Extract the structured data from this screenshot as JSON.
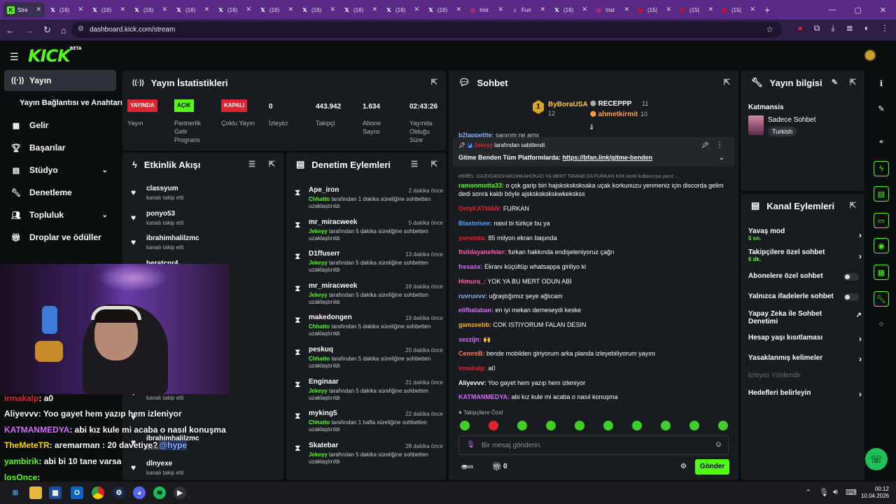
{
  "browser": {
    "tabs": [
      {
        "label": "Stre",
        "icon": "kick-icon",
        "color": "#53fc18"
      },
      {
        "label": "(16)",
        "icon": "x-icon",
        "color": "#ffffff"
      },
      {
        "label": "(16)",
        "icon": "x-icon",
        "color": "#ffffff"
      },
      {
        "label": "(16)",
        "icon": "x-icon",
        "color": "#ffffff"
      },
      {
        "label": "(16)",
        "icon": "x-icon",
        "color": "#ffffff"
      },
      {
        "label": "(16)",
        "icon": "x-icon",
        "color": "#ffffff"
      },
      {
        "label": "(16)",
        "icon": "x-icon",
        "color": "#ffffff"
      },
      {
        "label": "(16)",
        "icon": "x-icon",
        "color": "#ffffff"
      },
      {
        "label": "(16)",
        "icon": "x-icon",
        "color": "#ffffff"
      },
      {
        "label": "(16)",
        "icon": "x-icon",
        "color": "#ffffff"
      },
      {
        "label": "(16)",
        "icon": "x-icon",
        "color": "#ffffff"
      },
      {
        "label": "Inst",
        "icon": "instagram-icon",
        "color": "#e1306c"
      },
      {
        "label": "Furi",
        "icon": "tiktok-icon",
        "color": "#ffffff"
      },
      {
        "label": "(16)",
        "icon": "x-icon",
        "color": "#ffffff"
      },
      {
        "label": "Inst",
        "icon": "instagram-icon",
        "color": "#e1306c"
      },
      {
        "label": "(15(",
        "icon": "youtube-icon",
        "color": "#ff0000"
      },
      {
        "label": "(15(",
        "icon": "youtube-icon",
        "color": "#ff0000"
      },
      {
        "label": "(15(",
        "icon": "youtube-icon",
        "color": "#ff0000"
      }
    ],
    "new_tab": "+",
    "url": "dashboard.kick.com/stream"
  },
  "sidebar": {
    "items": [
      {
        "label": "Yayın",
        "icon": "broadcast-icon"
      },
      {
        "label": "Yayın Bağlantısı ve Anahtarı"
      },
      {
        "label": "Gelir",
        "icon": "money-icon"
      },
      {
        "label": "Başarılar",
        "icon": "trophy-icon"
      },
      {
        "label": "Stüdyo",
        "icon": "studio-icon"
      },
      {
        "label": "Denetleme",
        "icon": "wrench-icon"
      },
      {
        "label": "Topluluk",
        "icon": "community-icon"
      },
      {
        "label": "Droplar ve ödüller",
        "icon": "gift-icon"
      }
    ]
  },
  "stats": {
    "title": "Yayın İstatistikleri",
    "items": [
      {
        "badge": "YAYINDA",
        "badge_color": "#e0242f",
        "label": "Yayın"
      },
      {
        "badge": "AÇIK",
        "badge_color": "#53fc18",
        "label": "Partnerlik Gelir Programı"
      },
      {
        "badge": "KAPALI",
        "badge_color": "#e0242f",
        "label": "Çoklu Yayın"
      },
      {
        "value": "0",
        "label": "İzleyici"
      },
      {
        "value": "443.942",
        "label": "Takipçi"
      },
      {
        "value": "1.634",
        "label": "Abone Sayısı"
      },
      {
        "value": "02:43:26",
        "label": "Yayında Olduğu Süre"
      }
    ]
  },
  "activity": {
    "title": "Etkinlik Akışı",
    "rows": [
      {
        "name": "classyum",
        "sub": "kanalı takip etti",
        "time": "1 dakika önce"
      },
      {
        "name": "ponyo53",
        "sub": "kanalı takip etti",
        "time": "1 dakika önce"
      },
      {
        "name": "ibrahimhalilzmc",
        "sub": "kanalı takip etti",
        "time": "1 dakika önce"
      },
      {
        "name": "beratcnr4",
        "sub": "",
        "time": "2 dakika önce"
      },
      {
        "name": "",
        "sub": "",
        "time": "2 dakika önce"
      },
      {
        "name": "",
        "sub": "",
        "time": "3 dakika önce"
      },
      {
        "name": "",
        "sub": "",
        "time": "4 dakika önce"
      },
      {
        "name": "",
        "sub": "",
        "time": "4 dakika önce"
      },
      {
        "name": "",
        "sub": "kanalı takip etti",
        "time": "5 dakika önce"
      },
      {
        "name": "",
        "sub": "",
        "time": "5 dakika önce"
      },
      {
        "name": "ibrahimhalilzmc",
        "sub": "kanalı takip etti",
        "time": "6 dakika önce"
      },
      {
        "name": "dlnyexe",
        "sub": "kanalı takip etti",
        "time": "7 dakika önce"
      }
    ]
  },
  "moderation": {
    "title": "Denetim Eylemleri",
    "rows": [
      {
        "name": "Ape_iron",
        "time": "2 dakika önce",
        "mod": "Chhatto",
        "text": "tarafından 1 dakika süreliğine sohbetten uzaklaştırıldı"
      },
      {
        "name": "mr_miracweek",
        "time": "5 dakika önce",
        "mod": "Jekeyy",
        "text": "tarafından 5 dakika süreliğine sohbetten uzaklaştırıldı"
      },
      {
        "name": "D1ffuserr",
        "time": "13 dakika önce",
        "mod": "Jekeyy",
        "text": "tarafından 5 dakika süreliğine sohbetten uzaklaştırıldı"
      },
      {
        "name": "mr_miracweek",
        "time": "18 dakika önce",
        "mod": "Jekeyy",
        "text": "tarafından 5 dakika süreliğine sohbetten uzaklaştırıldı"
      },
      {
        "name": "makedongen",
        "time": "19 dakika önce",
        "mod": "Chhatto",
        "text": "tarafından 5 dakika süreliğine sohbetten uzaklaştırıldı"
      },
      {
        "name": "peskuq",
        "time": "20 dakika önce",
        "mod": "Chhatto",
        "text": "tarafından 5 dakika süreliğine sohbetten uzaklaştırıldı"
      },
      {
        "name": "Enginaar",
        "time": "21 dakika önce",
        "mod": "Jekeyy",
        "text": "tarafından 5 dakika süreliğine sohbetten uzaklaştırıldı"
      },
      {
        "name": "myking5",
        "time": "22 dakika önce",
        "mod": "Chhatto",
        "text": "tarafından 1 hafta süreliğine sohbetten uzaklaştırıldı"
      },
      {
        "name": "Skatebar",
        "time": "28 dakika önce",
        "mod": "Jekeyy",
        "text": "tarafından 5 dakika süreliğine sohbetten uzaklaştırıldı"
      }
    ]
  },
  "chat": {
    "title": "Sohbet",
    "top_gifter": {
      "rank": "1",
      "name": "ByBoraUSA",
      "count": "12"
    },
    "gifters": [
      {
        "name": "RECEPPP",
        "count": "11"
      },
      {
        "name": "ahmetkirmit",
        "count": "10"
      }
    ],
    "partial_line": {
      "name": "b2lappetite:",
      "text": "sanırım ne amx"
    },
    "pinned": {
      "by": "Jekeyy",
      "by_suffix": "tarafından sabitlendi",
      "text": "Gitme Benden Tüm Platformlarda:",
      "link": "https://bfan.link/gitme-benden"
    },
    "system_line": "elliiffff1: GAJDGAKDHAKDHKAHDKAD YA MERT TAMAM DA FURKAN KİM isimli kullanıcıya yanıt ...",
    "messages": [
      {
        "name": "ramonmotta33:",
        "color": "#53fc18",
        "text": "o çok garip biri hajsksksksksaka uçak korkunuzu yenmeniz için discorda gelim dedi sonra kaldı böyle ajsksksksksk​wkeksk​ss"
      },
      {
        "name": "OnlyKATMAN:",
        "color": "#e0242f",
        "text": "FURKAN"
      },
      {
        "name": "Blastoisee:",
        "color": "#4ea3ff",
        "text": "nasıl bi türkçe bu ya"
      },
      {
        "name": "yunemta:",
        "color": "#e0242f",
        "text": "85 milyon ekran başında"
      },
      {
        "name": "fisildayanefeler:",
        "color": "#ff5ca8",
        "text": "furkan hakkında endişeleniyoruz çağrı"
      },
      {
        "name": "fresasx:",
        "color": "#d56cff",
        "text": "Ekranı küçültüp whatsappa giriliyo ki"
      },
      {
        "name": "Himura_:",
        "color": "#ff5ca8",
        "text": "YOK YA BU MERT ODUN ABİ"
      },
      {
        "name": "ruvruvvv:",
        "color": "#8ab4ff",
        "text": "uğraştığımız şeye ağlıcam"
      },
      {
        "name": "elifbalaban:",
        "color": "#d56cff",
        "text": "en iyi mekan demeseydi keske"
      },
      {
        "name": "gamzeebb:",
        "color": "#ffb020",
        "text": "COK ISTIYORUM FALAN DESIN"
      },
      {
        "name": "sezzijn:",
        "color": "#d56cff",
        "text": "🙌"
      },
      {
        "name": "CemreB:",
        "color": "#ff7b54",
        "text": "bende mobilden giriyorum arka planda izleyebiliyorum yayını"
      },
      {
        "name": "irmakalp:",
        "color": "#e0242f",
        "text": "a0"
      },
      {
        "name": "Aliyevvv:",
        "color": "#ffffff",
        "text": "Yoo gayet hem yazıp hem izleniyor"
      },
      {
        "name": "KATMANMEDYA:",
        "color": "#d56cff",
        "text": "abi kız kule mi acaba o nasıl konuşma"
      }
    ],
    "followers_only": "Takipçilere Özel",
    "input_placeholder": "Bir mesaj gönderin",
    "kicks_count": "0",
    "send_label": "Gönder"
  },
  "stream_info": {
    "title": "Yayın bilgisi",
    "category_label": "Katmansis",
    "mode": "Sadece Sohbet",
    "language": "Turkish"
  },
  "channel_actions": {
    "title": "Kanal Eylemleri",
    "rows": [
      {
        "label": "Yavaş mod",
        "sub": "5 sn.",
        "control": "arrow"
      },
      {
        "label": "Takipçilere özel sohbet",
        "sub": "6 dk.",
        "control": "arrow"
      },
      {
        "label": "Abonelere özel sohbet",
        "sub": "",
        "control": "toggle"
      },
      {
        "label": "Yalnızca ifadelerle sohbet",
        "sub": "",
        "control": "toggle"
      },
      {
        "label": "Yapay Zeka ile Sohbet Denetimi",
        "sub": "",
        "control": "external"
      },
      {
        "label": "Hesap yaşı kısıtlaması",
        "sub": "",
        "control": "arrow"
      },
      {
        "label": "Yasaklanmış kelimeler",
        "sub": "",
        "control": "arrow"
      },
      {
        "label": "İzleyici Yönlendir",
        "sub": "",
        "control": "disabled"
      },
      {
        "label": "Hedefleri belirleyin",
        "sub": "",
        "control": "arrow"
      }
    ]
  },
  "overlay_chat": [
    {
      "name": "irmakalp",
      "text": ": a0",
      "color": "#e0242f"
    },
    {
      "name": "Aliyevvv",
      "text": ": Yoo gayet hem yazıp hem izleniyor",
      "color": "#ffffff"
    },
    {
      "name": "KATMANMEDYA",
      "text": ": abi kız kule mi acaba o nasıl konuşma",
      "color": "#d56cff"
    },
    {
      "name": "TheMeteTR",
      "text": ": aremarman : 20 davetiye?",
      "mention": "@hype",
      "color": "#ffd400"
    },
    {
      "name": "yambirik",
      "text": ": abi bi 10 tane varsa",
      "color": "#53fc18"
    },
    {
      "name": "losOnce",
      "text": ":",
      "color": "#53fc18"
    }
  ],
  "taskbar": {
    "time": "00:12",
    "date": "10.04.2026"
  },
  "colors": {
    "accent": "#53fc18",
    "panel": "#181b1f",
    "bg": "#0b0e0f",
    "browser": "#5b2a86"
  }
}
